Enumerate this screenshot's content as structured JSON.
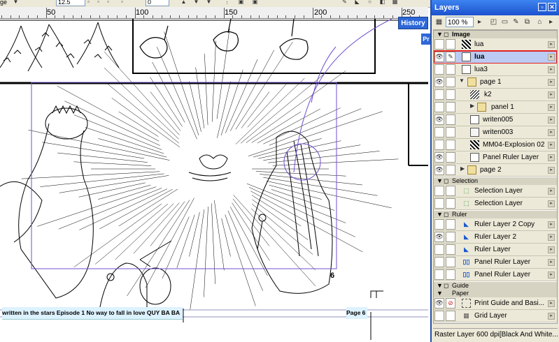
{
  "toolbar": {
    "left_text": "ge",
    "brush_size": "12.5",
    "value_field": "0"
  },
  "ruler": {
    "marks": [
      "50",
      "100",
      "150",
      "200",
      "250"
    ]
  },
  "canvas": {
    "credit_text": "written in the stars Episode 1 No way to fall in love  QUY BA BA",
    "page_label": "Page 6",
    "panel_number": "6"
  },
  "history_tab": "History",
  "pr_tab": "Pr",
  "layers_panel": {
    "title": "Layers",
    "zoom": "100 %",
    "groups": {
      "image": "Image",
      "selection": "Selection",
      "ruler": "Ruler",
      "guide": "Guide",
      "paper": "Paper"
    },
    "image_layers": [
      "lua",
      "lua",
      "lua3",
      "page 1",
      "k2",
      "panel 1",
      "writen005",
      "writen003",
      "MM04-Explosion 02",
      "Panel Ruler Layer",
      "page 2"
    ],
    "selection_layers": [
      "Selection Layer",
      "Selection Layer"
    ],
    "ruler_layers": [
      "Ruler Layer 2 Copy",
      "Ruler Layer 2",
      "Ruler Layer",
      "Panel Ruler Layer",
      "Panel Ruler Layer"
    ],
    "paper_layers": [
      "Print Guide and Basi...",
      "Grid Layer"
    ],
    "status": "Raster Layer 600 dpi[Black And White..."
  },
  "colors": {
    "title_bar": "#1c52cf",
    "selected_row": "#bccbf3",
    "highlight_border": "#e02020",
    "panel_bg": "#ece9d8"
  }
}
